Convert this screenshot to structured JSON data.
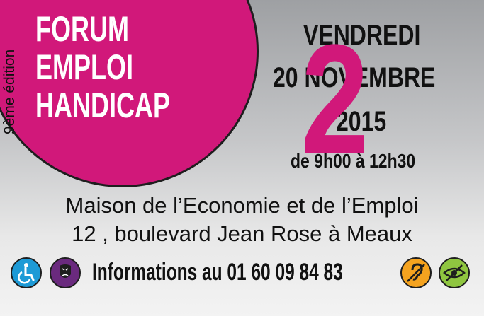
{
  "header": {
    "edition": "9ème édition",
    "title_lines": [
      "FORUM",
      "EMPLOI",
      "HANDICAP"
    ]
  },
  "event": {
    "day": "VENDREDI",
    "date_line": "20 NOVEMBRE",
    "year": "2015",
    "hours": "de 9h00 à 12h30",
    "big_number": "2"
  },
  "venue": {
    "name": "Maison de l’Economie et de l’Emploi",
    "address": "12 , boulevard Jean Rose à Meaux"
  },
  "contact": {
    "info": "Informations au 01 60 09 84 83"
  },
  "icons": [
    {
      "name": "wheelchair-icon",
      "color": "#1d9ad6"
    },
    {
      "name": "mental-disability-icon",
      "color": "#6a2a7e"
    },
    {
      "name": "hearing-impaired-icon",
      "color": "#f5a31f"
    },
    {
      "name": "visual-impaired-icon",
      "color": "#8fc640"
    }
  ],
  "colors": {
    "brand_pink": "#d1187a",
    "text_dark": "#111111"
  }
}
